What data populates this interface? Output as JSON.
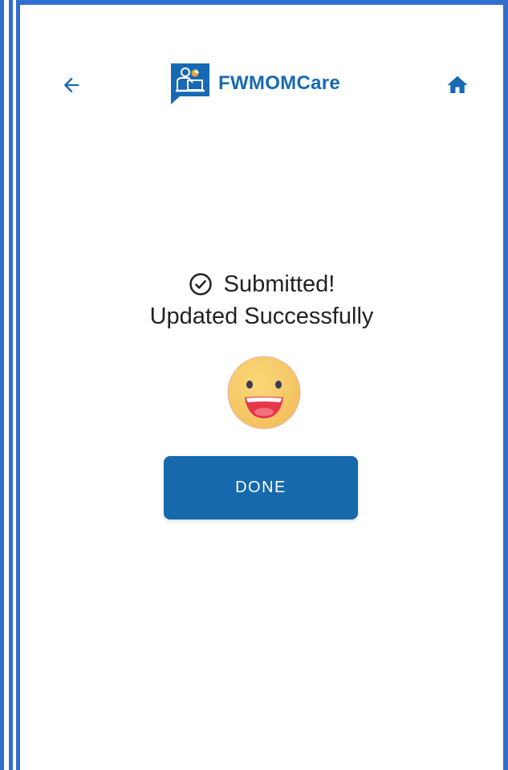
{
  "app": {
    "brand_name": "FWMOMCare",
    "brand_color": "#1769b3",
    "frame_color": "#2f6fcf"
  },
  "header": {
    "back_icon": "arrow-left-icon",
    "home_icon": "home-icon"
  },
  "status": {
    "icon": "check-circle-icon",
    "title": "Submitted!",
    "message": "Updated Successfully"
  },
  "emoji": {
    "icon": "smiling-face-icon"
  },
  "actions": {
    "done_label": "DONE",
    "done_color": "#1669ad"
  }
}
